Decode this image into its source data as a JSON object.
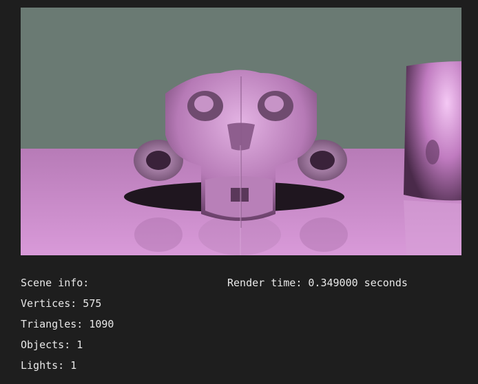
{
  "viewport": {
    "description_colors": {
      "sky": "#6a7a73",
      "floor": "#cf8fcf",
      "model": "#c98ec9",
      "background": "#1e1e1e"
    }
  },
  "info": {
    "scene_label": "Scene info:",
    "vertices": "Vertices: 575",
    "triangles": "Triangles: 1090",
    "objects": "Objects: 1",
    "lights": "Lights: 1",
    "render_time": "Render time: 0.349000 seconds"
  }
}
